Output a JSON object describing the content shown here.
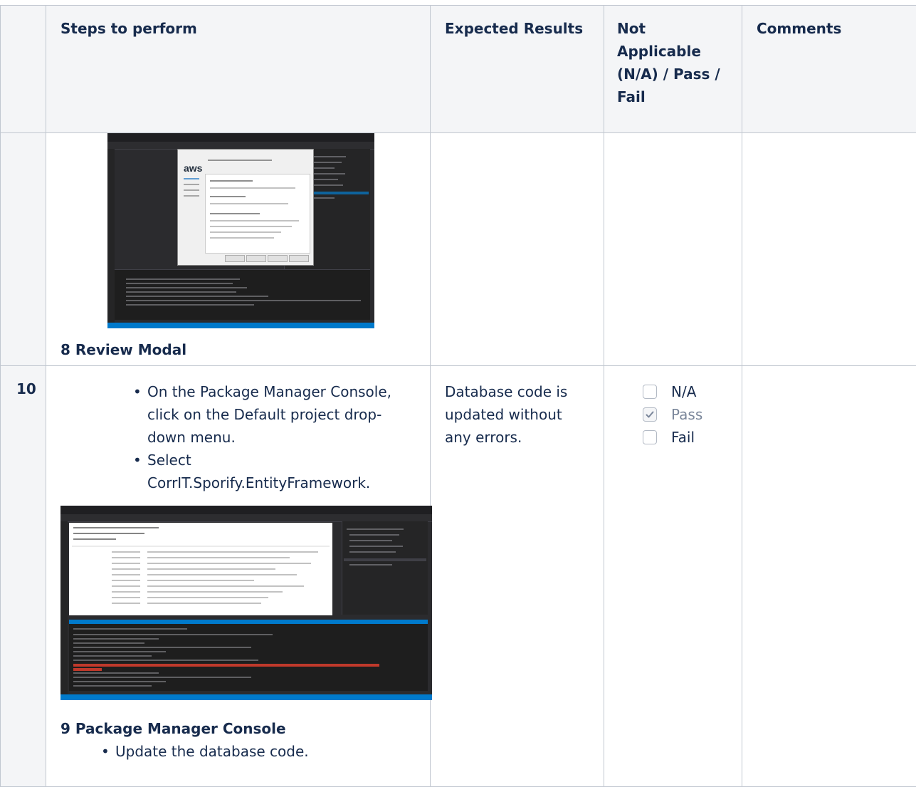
{
  "headers": {
    "steps": "Steps to perform",
    "expected": "Expected Results",
    "status": "Not Applicable (N/A) / Pass / Fail",
    "comments": "Comments"
  },
  "rows": [
    {
      "caption": "8 Review Modal",
      "screenshot_icon": "visual-studio-publish-review-screenshot",
      "screenshot_text": "aws"
    },
    {
      "number": "10",
      "steps": [
        "On the Package Manager Console, click on the Default project drop-down menu.",
        "Select CorrIT.Sporify.EntityFramework."
      ],
      "screenshot_icon": "package-manager-console-screenshot",
      "caption": "9 Package Manager Console",
      "sub_steps": [
        "Update the database code."
      ],
      "expected": "Database code is updated without any errors.",
      "options": [
        {
          "label": "N/A",
          "checked": false
        },
        {
          "label": "Pass",
          "checked": true
        },
        {
          "label": "Fail",
          "checked": false
        }
      ]
    }
  ],
  "colors": {
    "border": "#c1c7d0",
    "header_bg": "#f4f5f7",
    "text": "#172b4d",
    "muted": "#7a869a"
  }
}
